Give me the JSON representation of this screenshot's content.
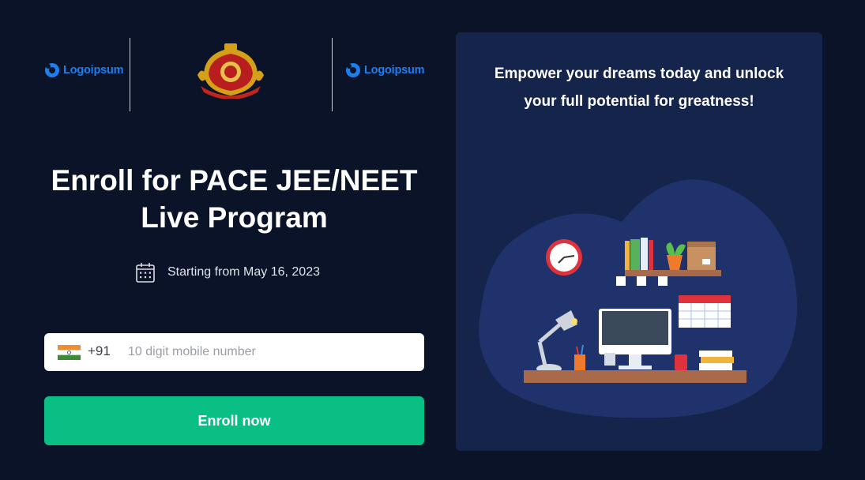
{
  "logos": {
    "left_text": "Logoipsum",
    "right_text": "Logoipsum",
    "emblem_name": "delhi-police-emblem"
  },
  "hero": {
    "title": "Enroll for PACE JEE/NEET Live Program",
    "start_date": "Starting from May 16, 2023"
  },
  "form": {
    "country_code": "+91",
    "phone_placeholder": "10 digit mobile number",
    "phone_value": "",
    "submit_label": "Enroll now"
  },
  "promo": {
    "tagline": "Empower your dreams today and unlock your full potential for greatness!"
  },
  "colors": {
    "background": "#0b1328",
    "card": "#15244a",
    "accent": "#0abf83",
    "logo_blue": "#1c7ff0"
  }
}
